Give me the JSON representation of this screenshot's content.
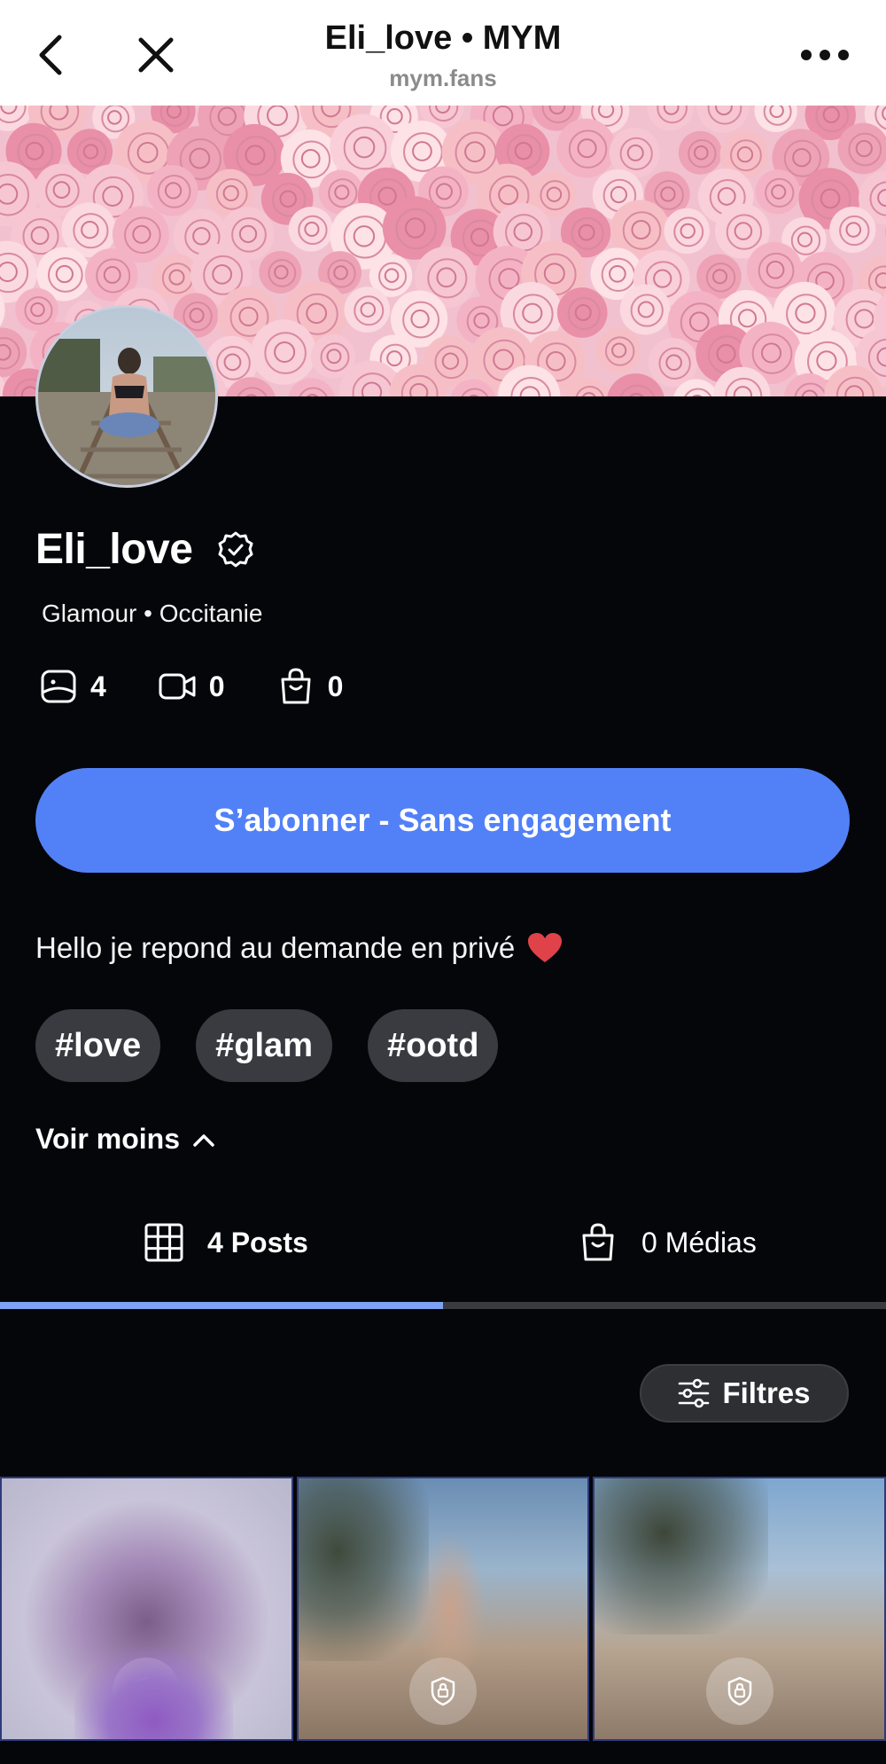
{
  "header": {
    "title": "Eli_love • MYM",
    "subtitle": "mym.fans"
  },
  "profile": {
    "name": "Eli_love",
    "meta": "Glamour • Occitanie",
    "stats": [
      {
        "icon": "photo-frame-icon",
        "value": "4"
      },
      {
        "icon": "video-camera-icon",
        "value": "0"
      },
      {
        "icon": "shopping-bag-icon",
        "value": "0"
      }
    ],
    "subscribe_label": "S’abonner - Sans engagement",
    "bio": "Hello je repond au demande en privé",
    "tags": [
      "#love",
      "#glam",
      "#ootd"
    ],
    "toggle_label": "Voir moins"
  },
  "tabs": [
    {
      "label": "4 Posts",
      "active": true
    },
    {
      "label": "0 Médias",
      "active": false
    }
  ],
  "filters_label": "Filtres",
  "colors": {
    "accent": "#5281f7",
    "background": "#05060a",
    "tag_bg": "#3a3b40",
    "heart": "#e0424a",
    "tab_active": "#7ea2f3"
  }
}
